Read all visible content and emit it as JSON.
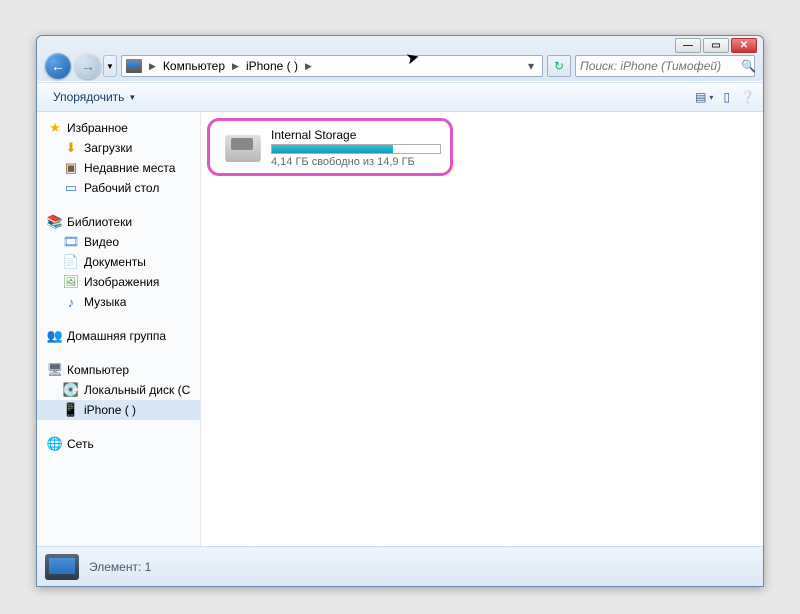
{
  "breadcrumb": {
    "root": "Компьютер",
    "device": "iPhone (            )"
  },
  "search": {
    "placeholder": "Поиск: iPhone (Тимофей)"
  },
  "toolbar": {
    "organize": "Упорядочить"
  },
  "sidebar": {
    "favorites": {
      "title": "Избранное",
      "downloads": "Загрузки",
      "recent": "Недавние места",
      "desktop": "Рабочий стол"
    },
    "libraries": {
      "title": "Библиотеки",
      "video": "Видео",
      "documents": "Документы",
      "images": "Изображения",
      "music": "Музыка"
    },
    "homegroup": {
      "title": "Домашняя группа"
    },
    "computer": {
      "title": "Компьютер",
      "localdisk": "Локальный диск (C",
      "iphone": "iPhone (            )"
    },
    "network": {
      "title": "Сеть"
    }
  },
  "drive": {
    "name": "Internal Storage",
    "subtext": "4,14 ГБ свободно из 14,9 ГБ",
    "fill_percent": 72
  },
  "status": {
    "text": "Элемент: 1"
  }
}
